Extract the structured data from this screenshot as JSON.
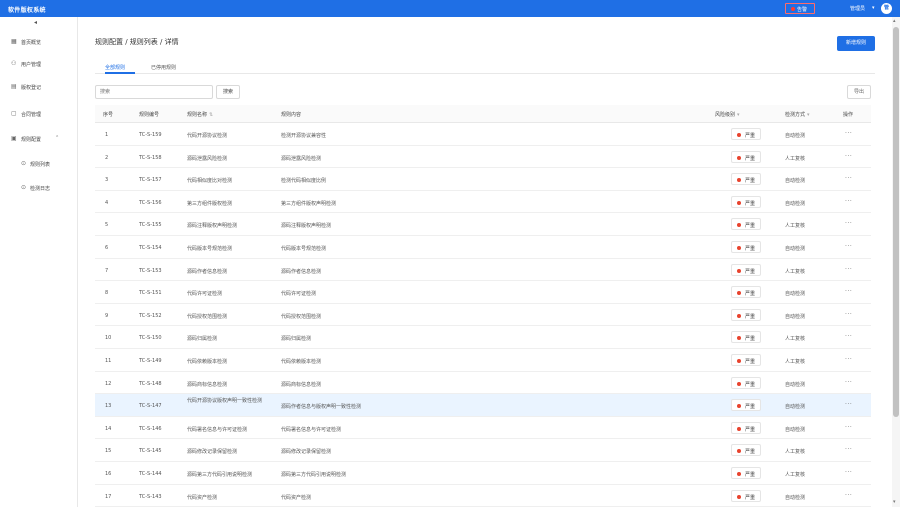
{
  "app": {
    "title": "软件版权系统"
  },
  "topbar": {
    "alert_label": "告警",
    "user_name": "管理员",
    "user_caret": "▾",
    "avatar_text": "管"
  },
  "sidebar": {
    "collapse": "◂",
    "items": [
      {
        "icon": "grid-icon",
        "glyph": "▦",
        "label": "首页概览"
      },
      {
        "icon": "user-icon",
        "glyph": "⚇",
        "label": "用户管理"
      },
      {
        "icon": "document-icon",
        "glyph": "▤",
        "label": "版权登记"
      },
      {
        "icon": "file-icon",
        "glyph": "▢",
        "label": "合同管理"
      },
      {
        "icon": "rules-icon",
        "glyph": "▣",
        "label": "规则配置",
        "chevron": "⌃"
      }
    ],
    "sub_items": [
      {
        "icon": "dot-icon",
        "glyph": "⊙",
        "label": "规则列表"
      },
      {
        "icon": "dot-icon",
        "glyph": "⊙",
        "label": "检测日志"
      }
    ]
  },
  "main": {
    "breadcrumb": "规则配置 / 规则列表 / 详情",
    "primary_button": "新增规则",
    "tabs": [
      "全部规则",
      "已停用规则"
    ],
    "search": {
      "placeholder": "搜索",
      "button": "搜索"
    },
    "export_button": "导出"
  },
  "table": {
    "headers": [
      {
        "label": "序号"
      },
      {
        "label": "规则编号"
      },
      {
        "label": "规则名称",
        "sort": "⇅"
      },
      {
        "label": "规则内容"
      },
      {
        "label": "风险级别",
        "sort": "▾"
      },
      {
        "label": "检测方式",
        "sort": "▾"
      },
      {
        "label": "操作"
      }
    ],
    "rows": [
      {
        "no": "1",
        "code": "TC-S-159",
        "name": "代码开源协议检测",
        "content": "检测开源协议兼容性",
        "level": "严重",
        "method": "自动检测",
        "more": "···"
      },
      {
        "no": "2",
        "code": "TC-S-158",
        "name": "源码泄露风险检测",
        "content": "源码泄露风险检测",
        "level": "严重",
        "method": "人工复核",
        "more": "···"
      },
      {
        "no": "3",
        "code": "TC-S-157",
        "name": "代码相似度比对检测",
        "content": "检测代码相似度比例",
        "level": "严重",
        "method": "自动检测",
        "more": "···"
      },
      {
        "no": "4",
        "code": "TC-S-156",
        "name": "第三方组件版权检测",
        "content": "第三方组件版权声明检测",
        "level": "严重",
        "method": "自动检测",
        "more": "···"
      },
      {
        "no": "5",
        "code": "TC-S-155",
        "name": "源码注释版权声明检测",
        "content": "源码注释版权声明检测",
        "level": "严重",
        "method": "人工复核",
        "more": "···"
      },
      {
        "no": "6",
        "code": "TC-S-154",
        "name": "代码版本号规范检测",
        "content": "代码版本号规范检测",
        "level": "严重",
        "method": "自动检测",
        "more": "···"
      },
      {
        "no": "7",
        "code": "TC-S-153",
        "name": "源码作者信息检测",
        "content": "源码作者信息检测",
        "level": "严重",
        "method": "人工复核",
        "more": "···"
      },
      {
        "no": "8",
        "code": "TC-S-151",
        "name": "代码许可证检测",
        "content": "代码许可证检测",
        "level": "严重",
        "method": "自动检测",
        "more": "···"
      },
      {
        "no": "9",
        "code": "TC-S-152",
        "name": "代码授权范围检测",
        "content": "代码授权范围检测",
        "level": "严重",
        "method": "自动检测",
        "more": "···"
      },
      {
        "no": "10",
        "code": "TC-S-150",
        "name": "源码归属检测",
        "content": "源码归属检测",
        "level": "严重",
        "method": "人工复核",
        "more": "···"
      },
      {
        "no": "11",
        "code": "TC-S-149",
        "name": "代码依赖版本检测",
        "content": "代码依赖版本检测",
        "level": "严重",
        "method": "人工复核",
        "more": "···"
      },
      {
        "no": "12",
        "code": "TC-S-148",
        "name": "源码商标信息检测",
        "content": "源码商标信息检测",
        "level": "严重",
        "method": "自动检测",
        "more": "···"
      },
      {
        "no": "13",
        "code": "TC-S-147",
        "name": "代码开源协议版权声明一致性检测",
        "content": "源码作者信息与版权声明一致性检测",
        "level": "严重",
        "method": "自动检测",
        "more": "···"
      },
      {
        "no": "14",
        "code": "TC-S-146",
        "name": "代码署名信息与许可证检测",
        "content": "代码署名信息与许可证检测",
        "level": "严重",
        "method": "自动检测",
        "more": "···"
      },
      {
        "no": "15",
        "code": "TC-S-145",
        "name": "源码修改记录保留检测",
        "content": "源码修改记录保留检测",
        "level": "严重",
        "method": "人工复核",
        "more": "···"
      },
      {
        "no": "16",
        "code": "TC-S-144",
        "name": "源码第三方代码引用说明检测",
        "content": "源码第三方代码引用说明检测",
        "level": "严重",
        "method": "人工复核",
        "more": "···"
      },
      {
        "no": "17",
        "code": "TC-S-143",
        "name": "代码资产检测",
        "content": "代码资产检测",
        "level": "严重",
        "method": "自动检测",
        "more": "···"
      }
    ]
  },
  "scrollbar": {
    "up": "▴",
    "down": "▾"
  },
  "colors": {
    "brand": "#1f6fe5",
    "danger": "#e8432e",
    "highlight_row": "#eaf4ff"
  }
}
